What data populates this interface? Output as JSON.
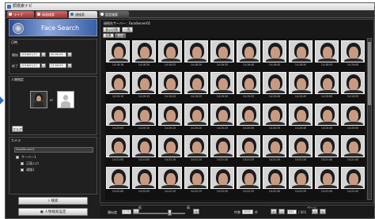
{
  "window": {
    "title": "顔検索ナビ"
  },
  "tabs": [
    {
      "label": "ライブ"
    },
    {
      "label": "録画検索"
    },
    {
      "label": "顔検索"
    },
    {
      "label": "設定検索"
    }
  ],
  "banner": {
    "title": "Face Search"
  },
  "conditions": {
    "header": "日時",
    "start_label": "開始",
    "start_date": "2016/01/21",
    "start_time": "00:00:00",
    "end_label": "終了",
    "end_date": "2016/01/21",
    "end_time": "23:59:59"
  },
  "person": {
    "header": "人物指定",
    "clear_label": "クリア",
    "or_label": "or"
  },
  "camera": {
    "header": "カメラ",
    "server": "FaceServer01",
    "items": [
      {
        "label": "サーバー1",
        "checked": true
      },
      {
        "label": "正面入口",
        "checked": true
      },
      {
        "label": "通路1",
        "checked": true
      }
    ]
  },
  "actions": {
    "search_label": "検索",
    "settings_label": "人物検索設定"
  },
  "main": {
    "server_label": "接続先サーバー：FaceServer01",
    "toolbar_btn1": "表示切替",
    "toolbar_btn2": "一覧",
    "subtab1": "結果",
    "subtab2": "履歴"
  },
  "results": [
    {
      "time": "14:18:16"
    },
    {
      "time": "14:18:20"
    },
    {
      "time": "14:18:25"
    },
    {
      "time": "14:18:30"
    },
    {
      "time": "14:18:35"
    },
    {
      "time": "14:18:40"
    },
    {
      "time": "14:18:45"
    },
    {
      "time": "14:18:50"
    },
    {
      "time": "14:18:55"
    },
    {
      "time": "14:19:00"
    },
    {
      "time": "14:19:10"
    },
    {
      "time": "14:19:15"
    },
    {
      "time": "14:19:20"
    },
    {
      "time": "14:19:25"
    },
    {
      "time": "14:19:30"
    },
    {
      "time": "14:19:35"
    },
    {
      "time": "14:19:40"
    },
    {
      "time": "14:19:45"
    },
    {
      "time": "14:19:50"
    },
    {
      "time": "14:19:55"
    },
    {
      "time": "14:20:05"
    },
    {
      "time": "14:20:10"
    },
    {
      "time": "14:20:15"
    },
    {
      "time": "14:20:20"
    },
    {
      "time": "14:20:25"
    },
    {
      "time": "14:20:30"
    },
    {
      "time": "14:20:35"
    },
    {
      "time": "14:20:40"
    },
    {
      "time": "14:20:45"
    },
    {
      "time": "14:20:50"
    },
    {
      "time": "14:21:00"
    },
    {
      "time": "14:21:05"
    },
    {
      "time": "14:21:10"
    },
    {
      "time": "14:21:15"
    },
    {
      "time": "14:21:20"
    },
    {
      "time": "14:21:25"
    },
    {
      "time": "14:21:30"
    },
    {
      "time": "14:21:35"
    },
    {
      "time": "14:21:40"
    },
    {
      "time": "14:21:45"
    },
    {
      "time": "14:22:00"
    },
    {
      "time": "14:22:05"
    },
    {
      "time": "14:22:10"
    },
    {
      "time": "14:22:15"
    },
    {
      "time": "14:22:20"
    },
    {
      "time": "14:22:25"
    },
    {
      "time": "14:22:30"
    },
    {
      "time": "14:22:35"
    },
    {
      "time": "14:22:40"
    },
    {
      "time": "14:22:45"
    }
  ],
  "bottom": {
    "threshold_label": "類似度",
    "threshold_value": "0.00",
    "slider_left_label": "低",
    "slider_right_label": "高",
    "count_label": "件数",
    "count_value": "1000",
    "count_unit": "件",
    "page_value": "001",
    "page_total": "/ 001",
    "page_label": "ページ"
  }
}
